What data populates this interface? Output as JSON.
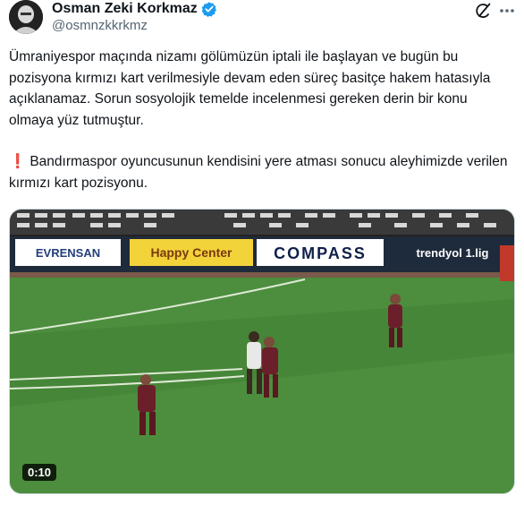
{
  "author": {
    "name": "Osman Zeki Korkmaz",
    "handle": "@osmnzkkrkmz"
  },
  "tweet": {
    "paragraph1": "Ümraniyespor maçında nizamı gölümüzün iptali ile başlayan ve bugün bu pozisyona kırmızı kart verilmesiyle devam eden süreç basitçe hakem hatasıyla açıklanamaz. Sorun sosyolojik temelde incelenmesi gereken derin bir konu olmaya yüz tutmuştur.",
    "paragraph2": "Bandırmaspor oyuncusunun kendisini yere atması sonucu aleyhimizde verilen kırmızı kart pozisyonu."
  },
  "video": {
    "timestamp": "0:10",
    "boards": [
      "EVRENSAN",
      "Happy Center",
      "COMPASS",
      "trendyol 1.lig"
    ]
  },
  "icons": {
    "verified": "verified-badge-icon",
    "grok": "grok-icon",
    "more": "more-options-icon",
    "alert": "exclamation-icon"
  },
  "colors": {
    "verified": "#1d9bf0",
    "pitch": "#4a8a3c",
    "text": "#0f1419",
    "secondary": "#536471"
  }
}
